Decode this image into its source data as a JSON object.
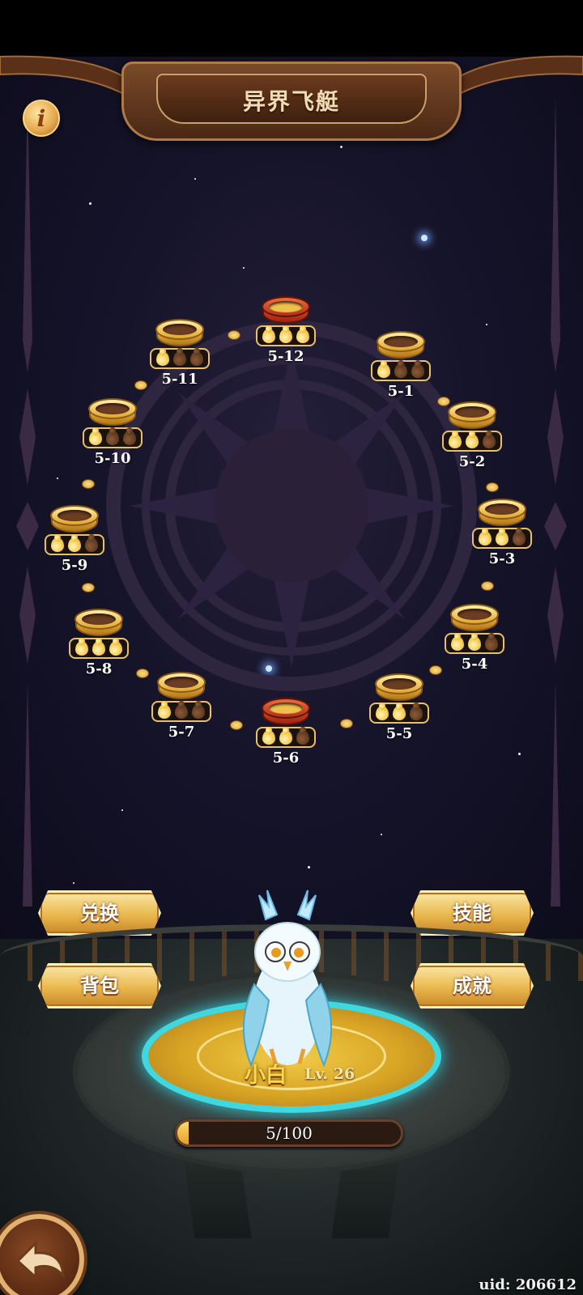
{
  "header": {
    "title": "异界飞艇",
    "info_glyph": "i"
  },
  "colors": {
    "gold": "#f4c64a",
    "dim_drop": "#5a3620",
    "boss_red": "#d83c1e",
    "teal_glow": "#3fd8e0"
  },
  "stages": [
    {
      "id": "5-1",
      "lit": 1,
      "boss": false
    },
    {
      "id": "5-2",
      "lit": 2,
      "boss": false
    },
    {
      "id": "5-3",
      "lit": 2,
      "boss": false
    },
    {
      "id": "5-4",
      "lit": 2,
      "boss": false
    },
    {
      "id": "5-5",
      "lit": 2,
      "boss": false
    },
    {
      "id": "5-6",
      "lit": 2,
      "boss": true
    },
    {
      "id": "5-7",
      "lit": 1,
      "boss": false
    },
    {
      "id": "5-8",
      "lit": 3,
      "boss": false
    },
    {
      "id": "5-9",
      "lit": 2,
      "boss": false
    },
    {
      "id": "5-10",
      "lit": 1,
      "boss": false
    },
    {
      "id": "5-11",
      "lit": 1,
      "boss": false
    },
    {
      "id": "5-12",
      "lit": 3,
      "boss": true
    }
  ],
  "menu": {
    "exchange": "兑换",
    "skills": "技能",
    "bag": "背包",
    "achievements": "成就"
  },
  "pet": {
    "name": "小白",
    "level": "Lv. 26",
    "exp_text": "5/100",
    "exp_fraction": 0.05,
    "icon": "owl-icon"
  },
  "footer": {
    "uid": "uid: 206612",
    "back_icon": "back-arrow-icon"
  }
}
